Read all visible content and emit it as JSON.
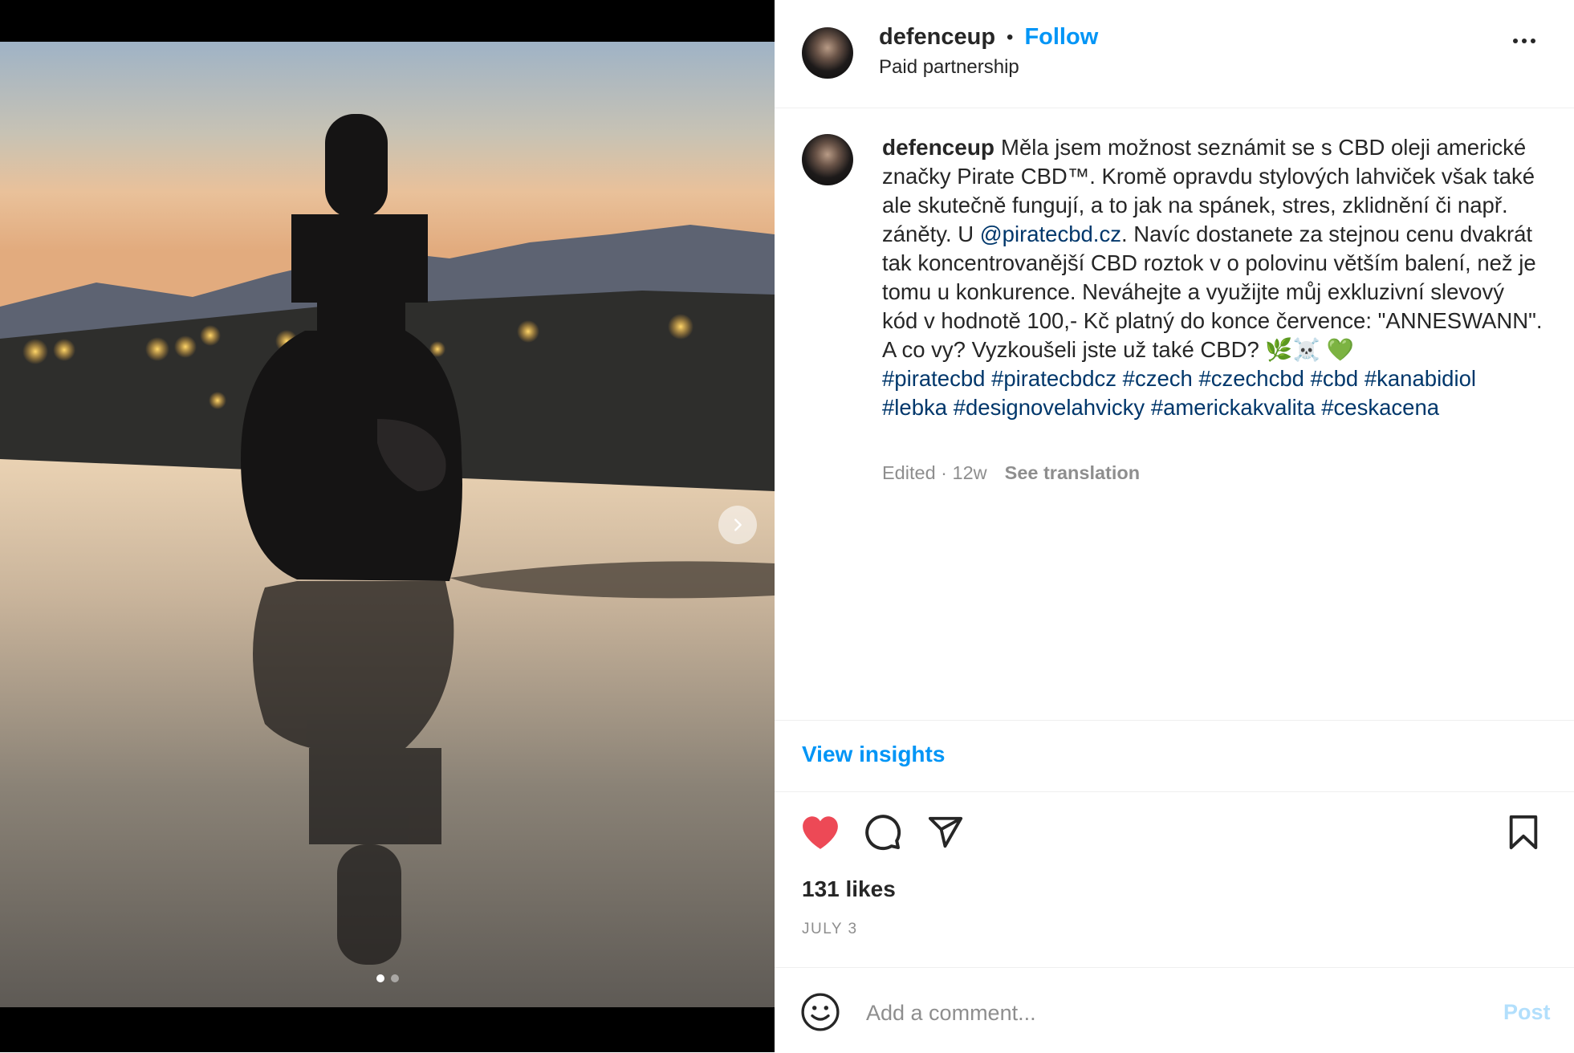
{
  "post": {
    "username": "defenceup",
    "separator": "•",
    "follow_label": "Follow",
    "subtitle": "Paid partnership",
    "more_icon": "more-horizontal-icon"
  },
  "media": {
    "slide_count": 2,
    "active_slide": 1,
    "next_icon": "chevron-right-icon"
  },
  "caption": {
    "username": "defenceup",
    "text_before_mention": "Měla jsem možnost seznámit se s CBD oleji americké značky Pirate CBD™. Kromě opravdu stylových lahviček však také ale skutečně fungují, a to jak na spánek, stres, zklidnění či např. záněty. U ",
    "mention": "@piratecbd.cz",
    "text_after_mention": ". Navíc dostanete za stejnou cenu dvakrát tak koncentrovanější CBD roztok v o polovinu větším balení, než je tomu u konkurence. Neváhejte a využijte můj exkluzivní slevový kód v hodnotě 100,- Kč platný do konce července: \"ANNESWANN\". A co vy? Vyzkoušeli jste už také CBD? 🌿☠️ 💚",
    "hashtags": [
      "#piratecbd",
      "#piratecbdcz",
      "#czech",
      "#czechcbd",
      "#cbd",
      "#kanabidiol",
      "#lebka",
      "#designovelahvicky",
      "#americkakvalita",
      "#ceskacena"
    ],
    "edited_meta": "Edited · 12w",
    "see_translation": "See translation"
  },
  "insights_label": "View insights",
  "actions": {
    "like_icon": "heart-filled-icon",
    "comment_icon": "comment-icon",
    "share_icon": "send-icon",
    "save_icon": "bookmark-icon",
    "like_color": "#ed4956"
  },
  "likes": "131 likes",
  "date": "JULY 3",
  "comment_box": {
    "emoji_icon": "emoji-icon",
    "placeholder": "Add a comment...",
    "post_label": "Post"
  },
  "colors": {
    "link_blue": "#0095f6",
    "mention_blue": "#00376b",
    "muted": "#8e8e8e"
  }
}
